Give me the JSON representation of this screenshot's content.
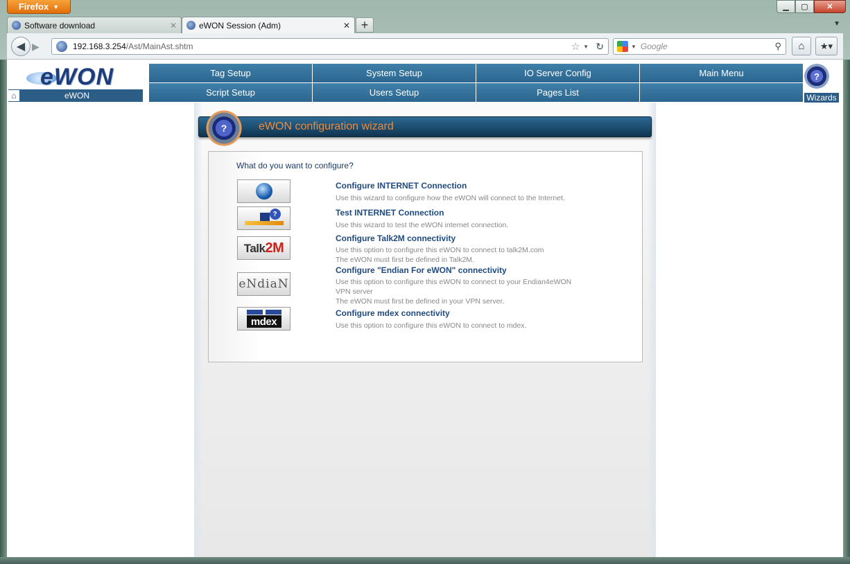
{
  "browser": {
    "app_button": "Firefox",
    "tabs": [
      {
        "label": "Software download"
      },
      {
        "label": "eWON Session (Adm)"
      }
    ],
    "url_host": "192.168.3.254",
    "url_path": "/Ast/MainAst.shtm",
    "search_placeholder": "Google"
  },
  "header": {
    "logo": "eWON",
    "home_label": "eWON",
    "menu_row1": [
      "Tag Setup",
      "System Setup",
      "IO Server Config",
      "Main Menu"
    ],
    "menu_row2": [
      "Script Setup",
      "Users Setup",
      "Pages List",
      ""
    ],
    "wizards_label": "Wizards"
  },
  "wizard": {
    "title": "eWON configuration wizard",
    "question": "What do you want to configure?",
    "options": [
      {
        "icon": "globe-icon",
        "title": "Configure INTERNET Connection",
        "desc": [
          "Use this wizard to configure how the eWON will connect to the Internet."
        ]
      },
      {
        "icon": "network-test-icon",
        "title": "Test INTERNET Connection",
        "desc": [
          "Use this wizard to test the eWON internet connection."
        ]
      },
      {
        "icon": "talk2m-logo",
        "logo_text_a": "Talk",
        "logo_text_b": "2M",
        "title": "Configure Talk2M connectivity",
        "desc": [
          "Use this option to configure this eWON to connect to talk2M.com",
          "The eWON must first be defined in Talk2M."
        ]
      },
      {
        "icon": "endian-logo",
        "logo_text": "eNdiaN",
        "title": "Configure \"Endian For eWON\" connectivity",
        "desc": [
          "Use this option to configure this eWON to connect to your Endian4eWON",
          "VPN server",
          "The eWON must first be defined in your VPN server."
        ]
      },
      {
        "icon": "mdex-logo",
        "logo_text": "mdex",
        "title": "Configure mdex connectivity",
        "desc": [
          "Use this option to configure this eWON to connect to mdex."
        ]
      }
    ]
  },
  "colors": {
    "menu_blue": "#2b6690",
    "title_orange": "#f08a3a",
    "link_blue": "#1f4a80"
  }
}
